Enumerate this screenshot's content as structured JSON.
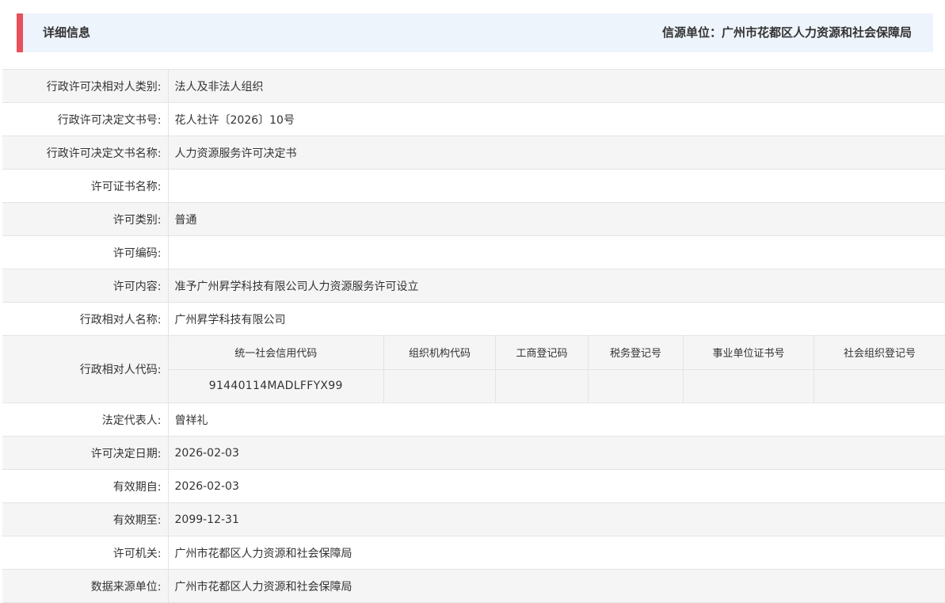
{
  "header": {
    "title": "详细信息",
    "source_label": "信源单位：广州市花都区人力资源和社会保障局",
    "accent_color": "#e8505b",
    "background_color": "#eef4fc"
  },
  "rows": [
    {
      "label": "行政许可决相对人类别:",
      "value": "法人及非法人组织"
    },
    {
      "label": "行政许可决定文书号:",
      "value": "花人社许〔2026〕10号"
    },
    {
      "label": "行政许可决定文书名称:",
      "value": "人力资源服务许可决定书"
    },
    {
      "label": "许可证书名称:",
      "value": ""
    },
    {
      "label": "许可类别:",
      "value": "普通"
    },
    {
      "label": "许可编码:",
      "value": ""
    },
    {
      "label": "许可内容:",
      "value": "准予广州昇学科技有限公司人力资源服务许可设立"
    },
    {
      "label": "行政相对人名称:",
      "value": "广州昇学科技有限公司"
    }
  ],
  "code_section": {
    "label": "行政相对人代码:",
    "headers": [
      "统一社会信用代码",
      "组织机构代码",
      "工商登记码",
      "税务登记号",
      "事业单位证书号",
      "社会组织登记号"
    ],
    "values": [
      "91440114MADLFFYX99",
      "",
      "",
      "",
      "",
      ""
    ]
  },
  "rows_after": [
    {
      "label": "法定代表人:",
      "value": "曾祥礼"
    },
    {
      "label": "许可决定日期:",
      "value": "2026-02-03"
    },
    {
      "label": "有效期自:",
      "value": "2026-02-03"
    },
    {
      "label": "有效期至:",
      "value": "2099-12-31"
    },
    {
      "label": "许可机关:",
      "value": "广州市花都区人力资源和社会保障局"
    },
    {
      "label": "数据来源单位:",
      "value": "广州市花都区人力资源和社会保障局"
    }
  ]
}
